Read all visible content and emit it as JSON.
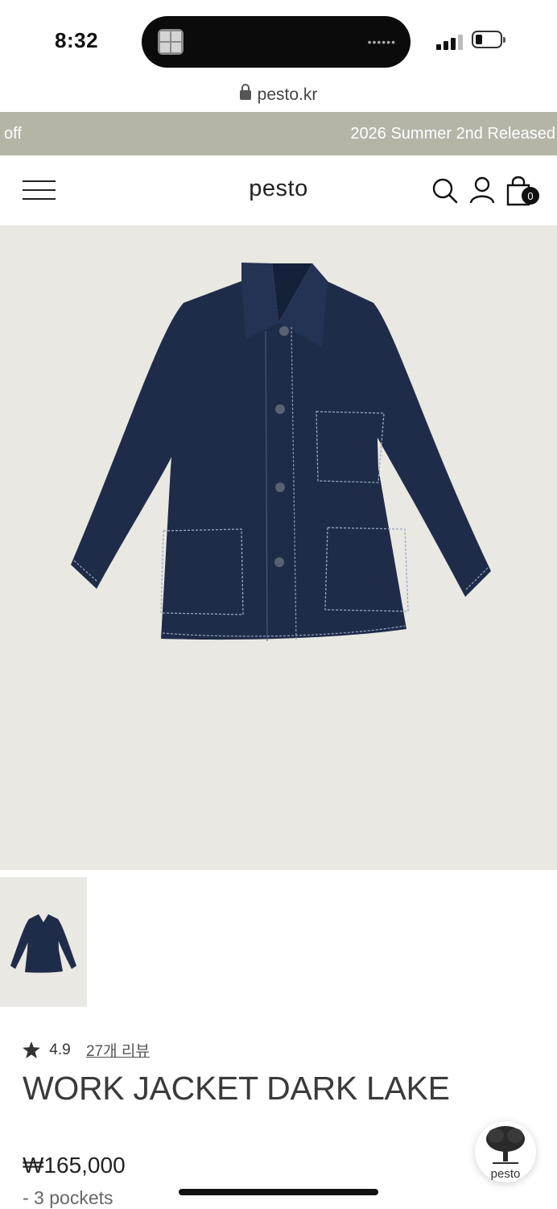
{
  "status_bar": {
    "time": "8:32"
  },
  "browser": {
    "url": "pesto.kr"
  },
  "promo": {
    "left_text": "off",
    "right_text": "2026 Summer 2nd Released"
  },
  "header": {
    "logo": "pesto",
    "cart_count": "0"
  },
  "product": {
    "rating": "4.9",
    "reviews_label": "27개 리뷰",
    "title": "WORK JACKET DARK LAKE",
    "price": "₩165,000",
    "description": "- 3 pockets"
  },
  "chat_widget": {
    "label": "pesto"
  },
  "colors": {
    "promo_bg": "#b4b5a7",
    "image_bg": "#e9e8e3",
    "jacket": "#1f2c49"
  }
}
